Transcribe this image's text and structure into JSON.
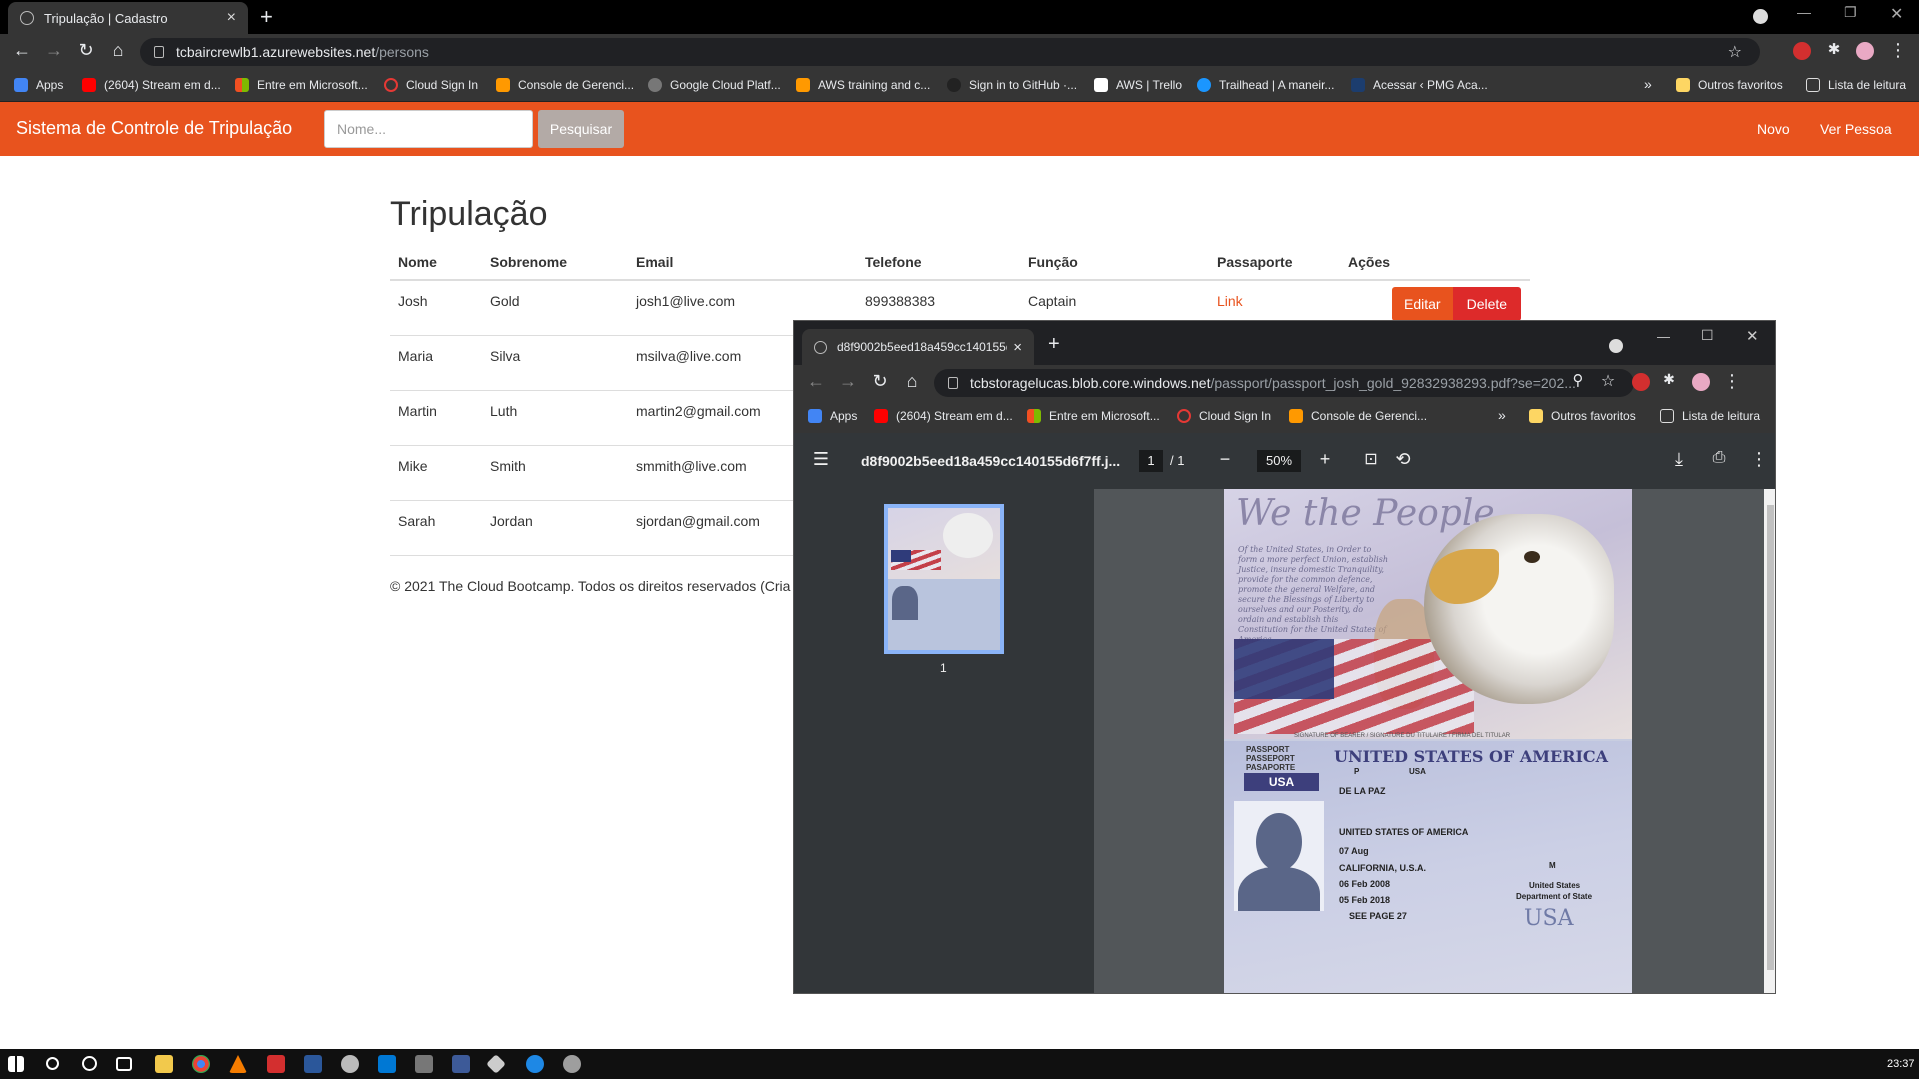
{
  "browser": {
    "tab_title": "Tripulação | Cadastro",
    "url_host": "tcbaircrewlb1.azurewebsites.net",
    "url_path": "/persons",
    "bookmarks": [
      "Apps",
      "(2604) Stream em d...",
      "Entre em Microsoft...",
      "Cloud Sign In",
      "Console de Gerenci...",
      "Google Cloud Platf...",
      "AWS training and c...",
      "Sign in to GitHub ·...",
      "AWS | Trello",
      "Trailhead | A maneir...",
      "Acessar ‹ PMG Aca..."
    ],
    "bookmarks_overflow": "»",
    "other_favorites": "Outros favoritos",
    "reading_list": "Lista de leitura"
  },
  "navbar": {
    "brand": "Sistema de Controle de Tripulação",
    "search_placeholder": "Nome...",
    "search_button": "Pesquisar",
    "links": [
      "Novo",
      "Ver Pessoa"
    ]
  },
  "page": {
    "title": "Tripulação",
    "columns": [
      "Nome",
      "Sobrenome",
      "Email",
      "Telefone",
      "Função",
      "Passaporte",
      "Ações"
    ],
    "rows": [
      {
        "nome": "Josh",
        "sobrenome": "Gold",
        "email": "josh1@live.com",
        "telefone": "899388383",
        "funcao": "Captain",
        "passaporte": "Link",
        "edit": "Editar",
        "delete": "Delete"
      },
      {
        "nome": "Maria",
        "sobrenome": "Silva",
        "email": "msilva@live.com"
      },
      {
        "nome": "Martin",
        "sobrenome": "Luth",
        "email": "martin2@gmail.com"
      },
      {
        "nome": "Mike",
        "sobrenome": "Smith",
        "email": "smmith@live.com"
      },
      {
        "nome": "Sarah",
        "sobrenome": "Jordan",
        "email": "sjordan@gmail.com"
      }
    ],
    "footer": "© 2021 The Cloud Bootcamp. Todos os direitos reservados (Cria"
  },
  "popup": {
    "tab_title": "d8f9002b5eed18a459cc140155d",
    "url_host": "tcbstoragelucas.blob.core.windows.net",
    "url_path": "/passport/passport_josh_gold_92832938293.pdf?se=202...",
    "bookmarks": [
      "Apps",
      "(2604) Stream em d...",
      "Entre em Microsoft...",
      "Cloud Sign In",
      "Console de Gerenci..."
    ],
    "bookmarks_overflow": "»",
    "other_favorites": "Outros favoritos",
    "reading_list": "Lista de leitura",
    "pdf_title": "d8f9002b5eed18a459cc140155d6f7ff.j...",
    "pdf_page": "1",
    "pdf_total": "/  1",
    "pdf_zoom": "50%",
    "thumb_number": "1",
    "passport": {
      "script": "We the People",
      "preamble": "Of the United States, in Order to form a more perfect Union, establish Justice, insure domestic Tranquility, provide for the common defence, promote the general Welfare, and secure the Blessings of Liberty to ourselves and our Posterity, do ordain and establish this Constitution for the United States of America.",
      "signature_label": "SIGNATURE OF BEARER / SIGNATURE DU TITULAIRE / FIRMA DEL TITULAR",
      "country": "UNITED STATES OF AMERICA",
      "kind": [
        "PASSPORT",
        "PASSEPORT",
        "PASAPORTE"
      ],
      "usa_tag": "USA",
      "type": "P",
      "code": "USA",
      "surname": "DE LA PAZ",
      "nationality": "UNITED STATES OF AMERICA",
      "birth_date": "07 Aug",
      "birth_place": "CALIFORNIA, U.S.A.",
      "issue_date": "06 Feb 2008",
      "expiry_date": "05 Feb 2018",
      "endorsements": "SEE PAGE 27",
      "sex": "M",
      "authority": [
        "United States",
        "Department of State"
      ],
      "usa_big": "USA"
    }
  },
  "taskbar": {
    "clock": "23:37"
  }
}
